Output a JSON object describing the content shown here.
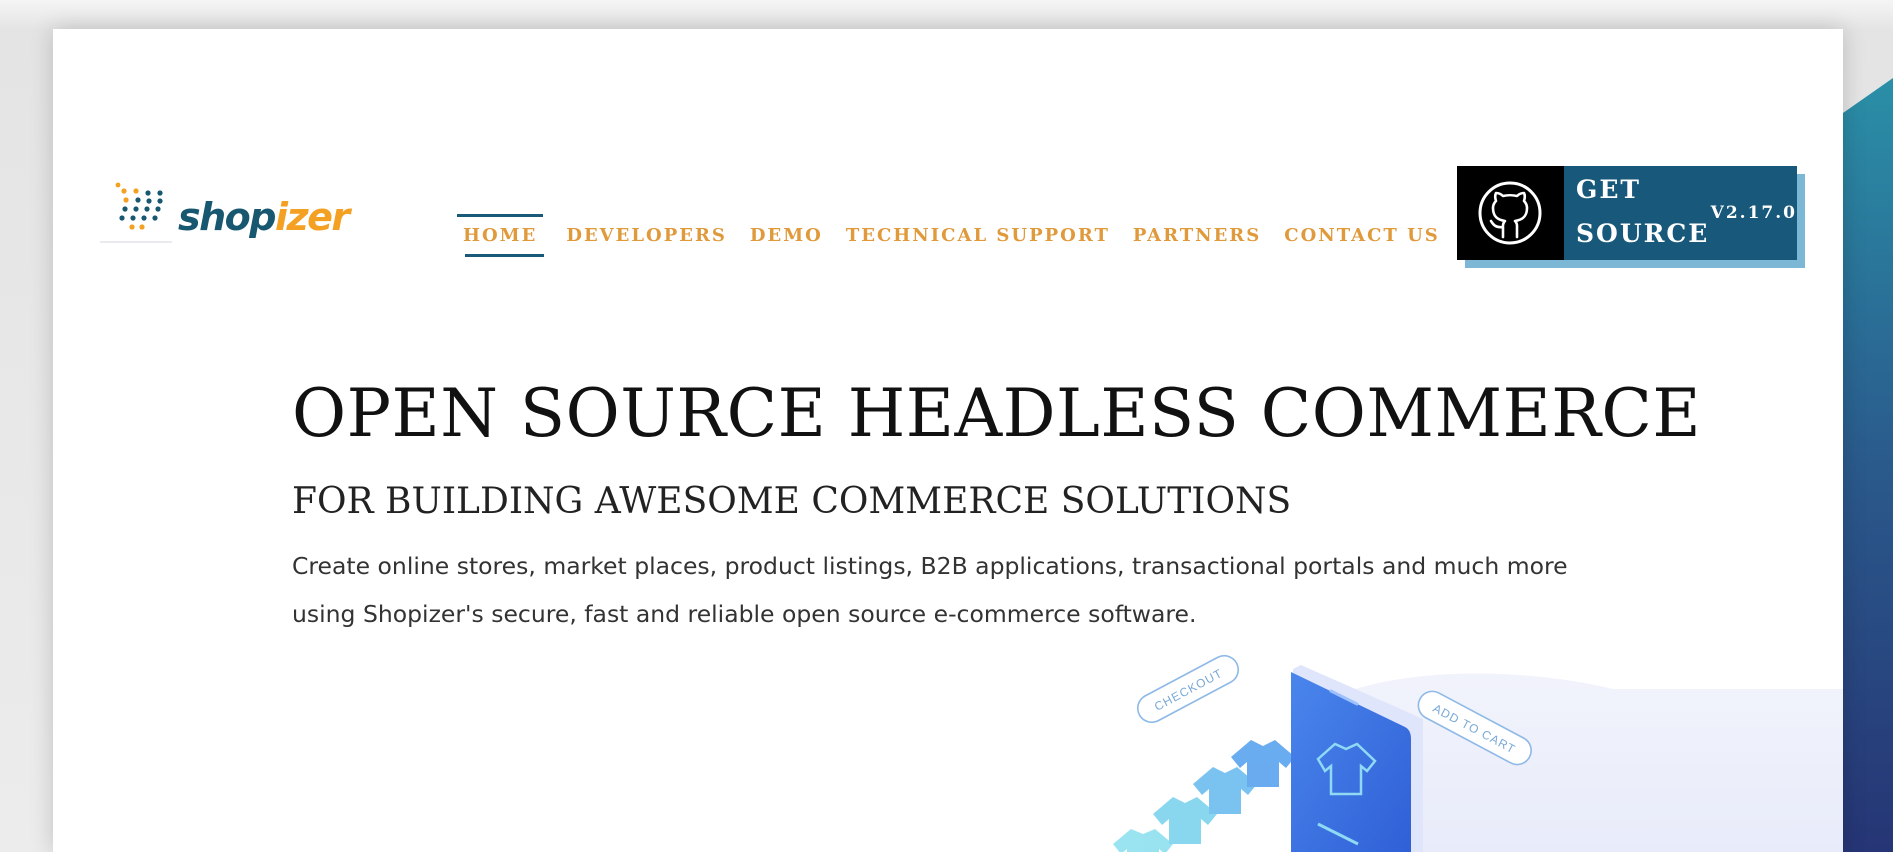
{
  "brand": {
    "name_part1": "shop",
    "name_part2": "izer",
    "logo_icon": "shopizer-dots-logo"
  },
  "nav": {
    "items": [
      {
        "label": "HOME",
        "active": true
      },
      {
        "label": "DEVELOPERS",
        "active": false
      },
      {
        "label": "DEMO",
        "active": false
      },
      {
        "label": "TECHNICAL SUPPORT",
        "active": false
      },
      {
        "label": "PARTNERS",
        "active": false
      },
      {
        "label": "CONTACT US",
        "active": false
      }
    ]
  },
  "get_source": {
    "label": "GET SOURCE",
    "version": "V2.17.0",
    "icon": "github-icon"
  },
  "hero": {
    "title": "OPEN SOURCE HEADLESS COMMERCE",
    "subtitle": "FOR BUILDING AWESOME COMMERCE SOLUTIONS",
    "description": "Create online stores, market places, product listings, B2B applications, transactional portals and much more using Shopizer's secure, fast and reliable open source e-commerce software."
  },
  "illustration": {
    "checkout_tag": "CHECKOUT",
    "add_to_cart_tag": "ADD TO CART"
  },
  "colors": {
    "nav_text": "#e09a3c",
    "nav_active_line": "#1a5a79",
    "brand_blue": "#17576f",
    "brand_orange": "#f3a023",
    "button_blue": "#17587b",
    "button_shadow": "#7db7d6"
  }
}
